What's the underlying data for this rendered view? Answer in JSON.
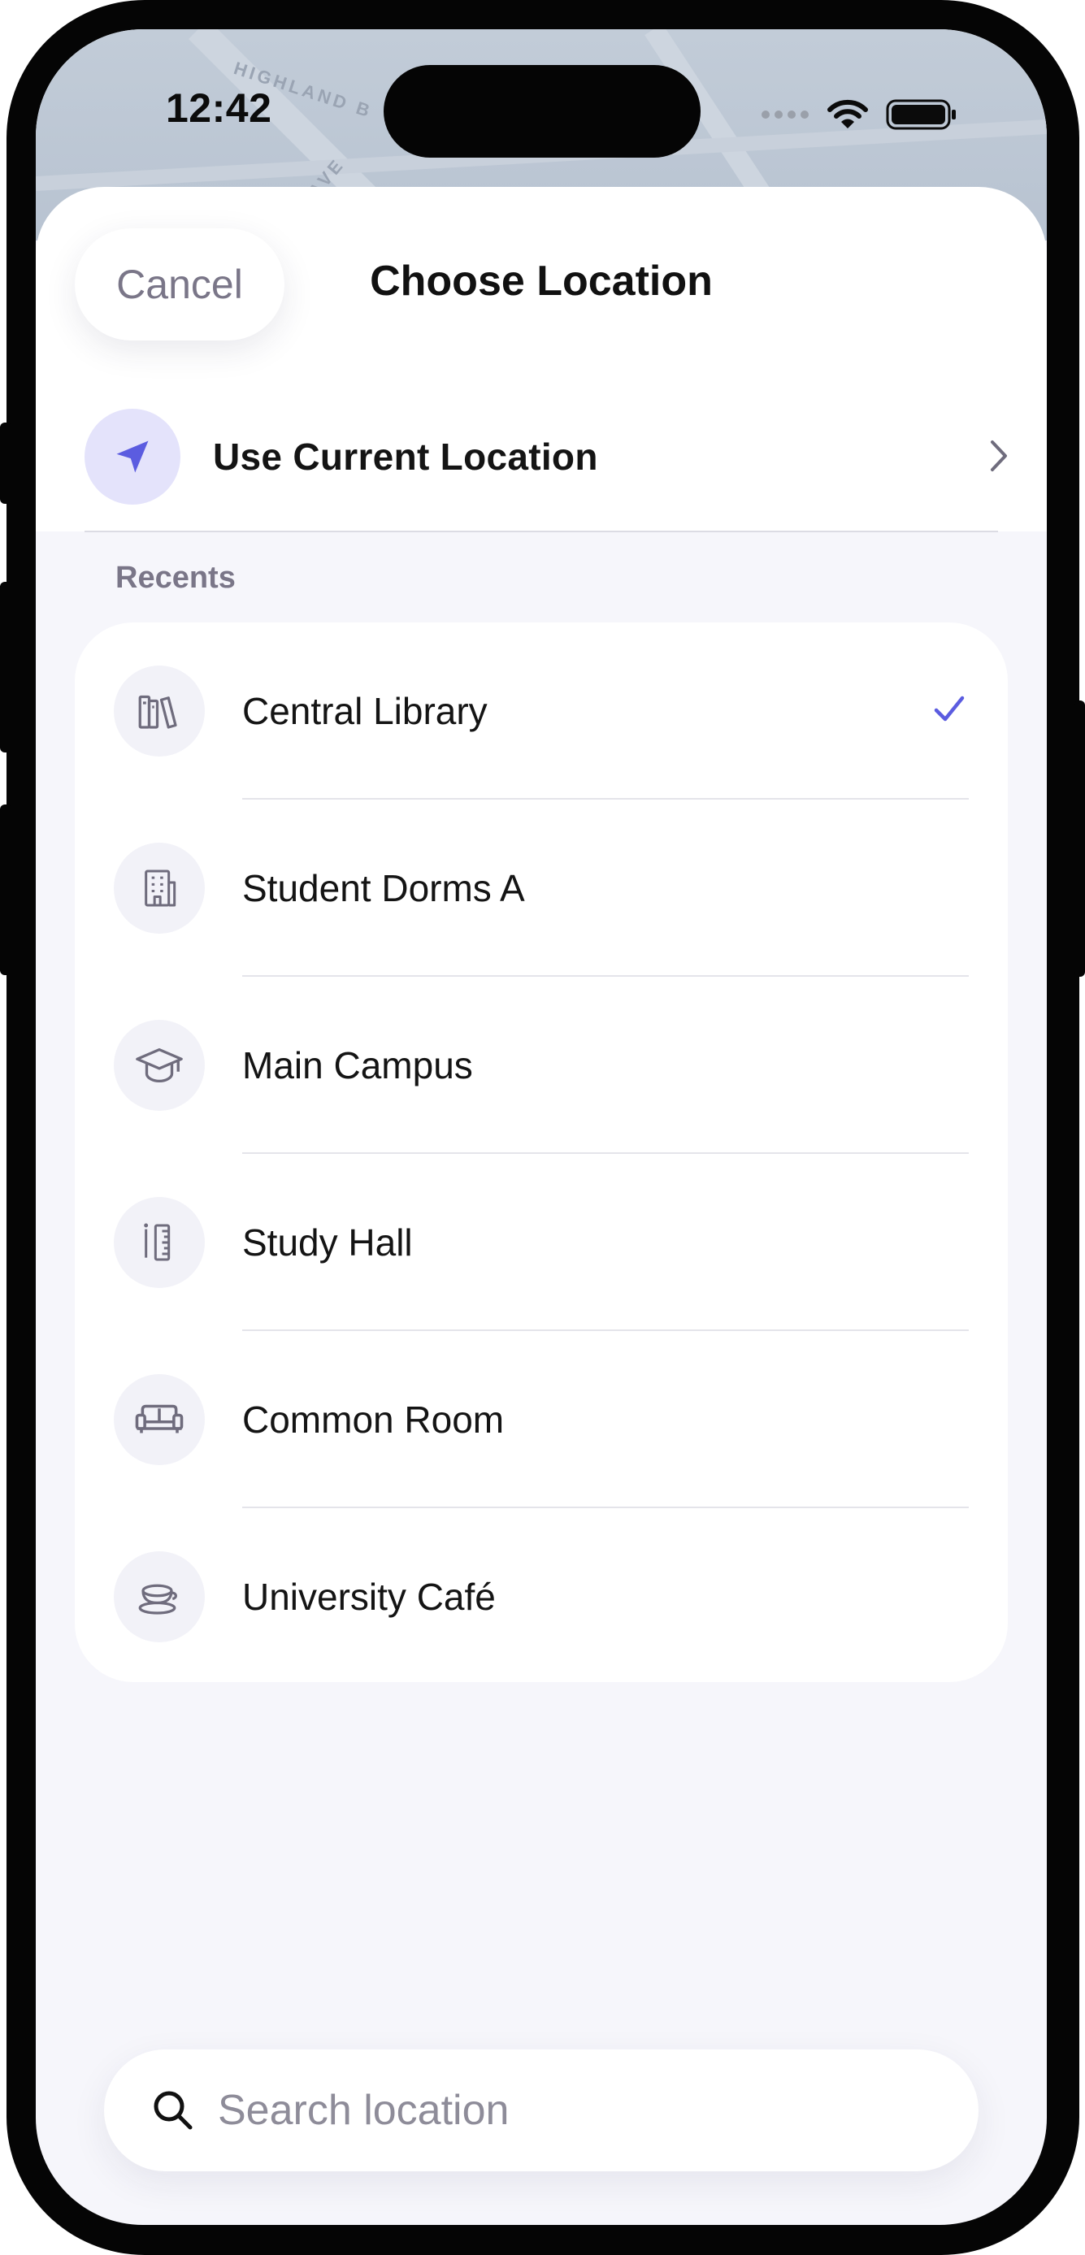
{
  "status_bar": {
    "time": "12:42"
  },
  "map_labels": {
    "street_1": "HIGHLAND B",
    "street_2": "AVE"
  },
  "header": {
    "cancel_label": "Cancel",
    "title": "Choose Location"
  },
  "current_location": {
    "label": "Use Current Location",
    "icon": "location-arrow-icon"
  },
  "recents": {
    "heading": "Recents",
    "items": [
      {
        "label": "Central Library",
        "icon": "books-icon",
        "selected": true
      },
      {
        "label": "Student Dorms A",
        "icon": "building-icon",
        "selected": false
      },
      {
        "label": "Main Campus",
        "icon": "graduation-cap-icon",
        "selected": false
      },
      {
        "label": "Study Hall",
        "icon": "ruler-pencil-icon",
        "selected": false
      },
      {
        "label": "Common Room",
        "icon": "sofa-icon",
        "selected": false
      },
      {
        "label": "University Café",
        "icon": "coffee-cup-icon",
        "selected": false
      }
    ]
  },
  "search": {
    "placeholder": "Search location",
    "value": ""
  },
  "colors": {
    "accent": "#5b5ce0",
    "icon_gray": "#6f6c7d",
    "background": "#f6f6fb"
  }
}
